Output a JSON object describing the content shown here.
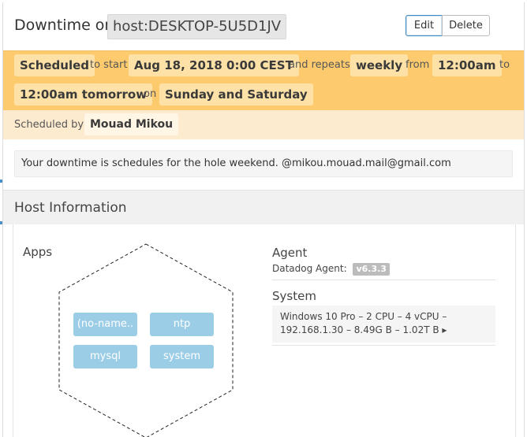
{
  "header": {
    "title_prefix": "Downtime on",
    "host": "host:DESKTOP-5U5D1JV",
    "edit_label": "Edit",
    "delete_label": "Delete"
  },
  "schedule": {
    "status": "Scheduled",
    "to_start": "to start",
    "start_time": "Aug 18, 2018 0:00 CEST",
    "and_repeats": "and repeats",
    "frequency": "weekly",
    "from": "from",
    "from_time": "12:00am",
    "to": "to",
    "to_time": "12:00am tomorrow",
    "on": "on",
    "days": "Sunday and Saturday"
  },
  "scheduled_by": {
    "label": "Scheduled by",
    "user": "Mouad Mikou"
  },
  "message": "Your downtime is schedules for the hole weekend. @mikou.mouad.mail@gmail.com",
  "host_info": {
    "title": "Host Information",
    "apps_label": "Apps",
    "apps": [
      "(no-name..",
      "ntp",
      "mysql",
      "system"
    ],
    "agent_title": "Agent",
    "agent_label": "Datadog Agent:",
    "agent_version": "v6.3.3",
    "system_title": "System",
    "system_line1": "Windows 10 Pro – 2 CPU – 4 vCPU –",
    "system_line2": "192.168.1.30 – 8.49G B – 1.02T B ▸"
  },
  "colors": {
    "schedule_bg": "#fdcb6e",
    "chip_bg": "#fde1a6",
    "app_tile": "#9ccde6",
    "edit_border": "#3d8bc2"
  }
}
